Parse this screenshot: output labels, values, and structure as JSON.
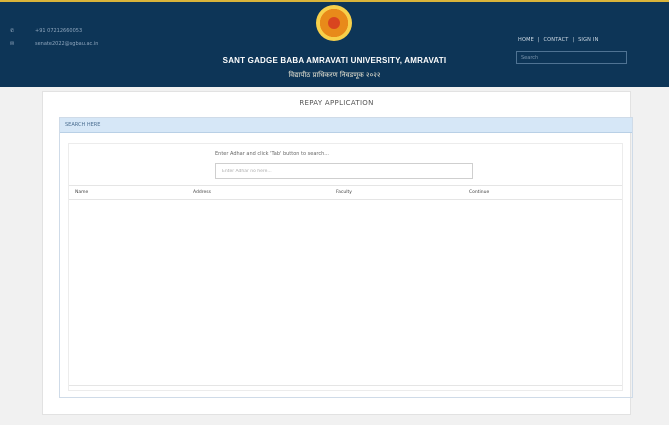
{
  "header": {
    "phone": "+91 07212660053",
    "email": "senate2022@sgbau.ac.in",
    "university_name": "SANT GADGE BABA AMRAVATI UNIVERSITY, AMRAVATI",
    "university_subtitle": "विद्यापीठ प्राधिकरण निवडणूक २०२२",
    "nav": {
      "home": "HOME",
      "sep1": "|",
      "contact": "CONTACT",
      "sep2": "|",
      "signin": "SIGN IN"
    },
    "search_placeholder": "Search"
  },
  "page": {
    "title": "REPAY APPLICATION",
    "section_title": "SEARCH HERE",
    "instruction": "Enter Adhar and click 'Tab' button to search...",
    "adhar_placeholder": "Enter Adhar no here...",
    "table": {
      "columns": [
        "Name",
        "Address",
        "Faculty",
        "Continue"
      ]
    }
  },
  "colors": {
    "header_bg": "#0d3557",
    "section_head_bg": "#d6e7f7",
    "page_bg": "#f1f1f1"
  }
}
